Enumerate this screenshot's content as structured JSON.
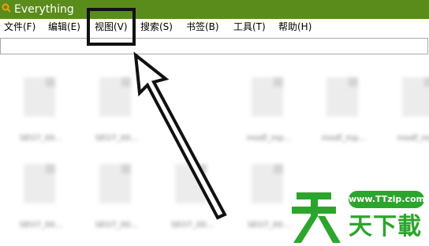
{
  "window": {
    "title": "Everything"
  },
  "menu": [
    {
      "label": "文件(F)",
      "name": "menu-file"
    },
    {
      "label": "编辑(E)",
      "name": "menu-edit"
    },
    {
      "label": "视图(V)",
      "name": "menu-view"
    },
    {
      "label": "搜索(S)",
      "name": "menu-search"
    },
    {
      "label": "书签(B)",
      "name": "menu-bookmarks"
    },
    {
      "label": "工具(T)",
      "name": "menu-tools"
    },
    {
      "label": "帮助(H)",
      "name": "menu-help"
    }
  ],
  "search": {
    "value": "",
    "placeholder": ""
  },
  "files": [
    {
      "name": "SEO7_00..."
    },
    {
      "name": "SEO7_00..."
    },
    {
      "name": "modf_mp..."
    },
    {
      "name": "modf_mp..."
    },
    {
      "name": "modf_mp..."
    },
    {
      "name": "modf_mp..."
    },
    {
      "name": "SEO7_00..."
    },
    {
      "name": "SEO7_00..."
    },
    {
      "name": "SEO7_00..."
    },
    {
      "name": "SEO7_00..."
    },
    {
      "name": "SEO7_00..."
    },
    {
      "name": "SEO7_00..."
    }
  ],
  "annotation": {
    "highlight": "menu-view",
    "arrow": "pointing-up-left"
  },
  "watermark": {
    "url": "www.TTzip.com",
    "logo_char": "天",
    "text": "天下載"
  },
  "colors": {
    "titlebar": "#5a8c1b",
    "watermark": "#2ca52c"
  }
}
